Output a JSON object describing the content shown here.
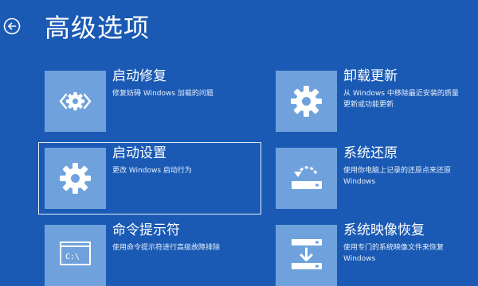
{
  "header": {
    "title": "高级选项",
    "back_icon": "back-arrow-icon"
  },
  "options": [
    {
      "key": "startup-repair",
      "title": "启动修复",
      "desc_lines": [
        "修复妨碍 Windows 加载的问题"
      ],
      "icon": "gear-code-icon"
    },
    {
      "key": "uninstall-updates",
      "title": "卸载更新",
      "desc_lines": [
        "从 Windows 中移除最近安装的质量",
        "更新或功能更新"
      ],
      "icon": "gear-icon"
    },
    {
      "key": "startup-settings",
      "title": "启动设置",
      "desc_lines": [
        "更改 Windows 启动行为"
      ],
      "icon": "gear-icon",
      "selected": true
    },
    {
      "key": "system-restore",
      "title": "系统还原",
      "desc_lines": [
        "使用你电脑上记录的还原点来还原",
        "Windows"
      ],
      "icon": "restore-drive-icon"
    },
    {
      "key": "command-prompt",
      "title": "命令提示符",
      "desc_lines": [
        "使用命令提示符进行高级故障排除"
      ],
      "icon": "command-prompt-icon",
      "prompt_text": "C:\\"
    },
    {
      "key": "system-image-recovery",
      "title": "系统映像恢复",
      "desc_lines": [
        "使用专门的系统映像文件来恢复",
        "Windows"
      ],
      "icon": "image-recovery-icon"
    }
  ],
  "colors": {
    "background": "#1a5ab4",
    "tile": "#6fa2dc",
    "text": "#ffffff"
  }
}
